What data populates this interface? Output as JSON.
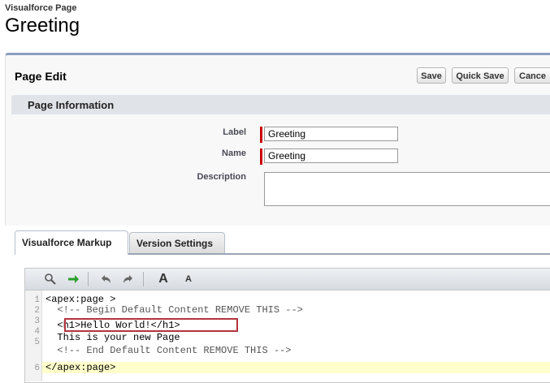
{
  "header": {
    "breadcrumb": "Visualforce Page",
    "title": "Greeting"
  },
  "page_block": {
    "title": "Page Edit",
    "buttons": {
      "save": "Save",
      "quick_save": "Quick Save",
      "cancel": "Cance"
    }
  },
  "section": {
    "title": "Page Information",
    "label": {
      "label": "Label",
      "value": "Greeting"
    },
    "name": {
      "label": "Name",
      "value": "Greeting"
    },
    "description": {
      "label": "Description",
      "value": ""
    }
  },
  "tabs": [
    {
      "label": "Visualforce Markup",
      "active": true
    },
    {
      "label": "Version Settings",
      "active": false
    }
  ],
  "toolbar": {
    "font_large": "A",
    "font_small": "A"
  },
  "code": {
    "line_numbers": [
      "1",
      "2",
      "3",
      "4",
      "5",
      "6"
    ],
    "lines": [
      "<apex:page >",
      "  <!-- Begin Default Content REMOVE THIS -->",
      "  <h1>Hello World!</h1>",
      "  This is your new Page",
      "  <!-- End Default Content REMOVE THIS -->",
      "</apex:page>"
    ]
  },
  "colors": {
    "required_marker": "#cc0000",
    "highlight_box": "#b2343d",
    "block_border": "#8a9ebe"
  }
}
